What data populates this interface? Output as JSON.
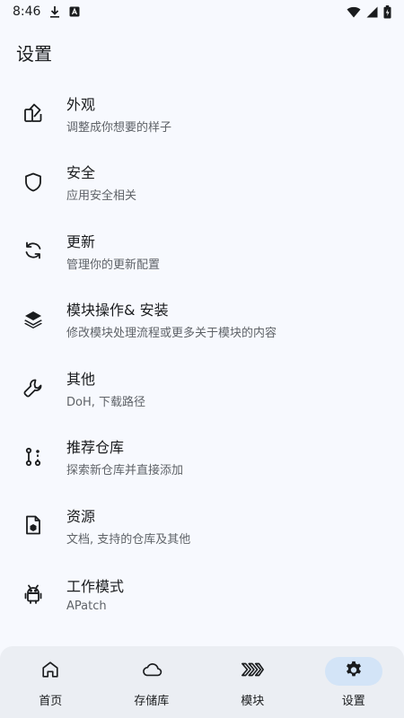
{
  "status_bar": {
    "time": "8:46",
    "icons": [
      "download-icon",
      "notification-a-icon",
      "wifi-icon",
      "signal-icon",
      "battery-icon"
    ]
  },
  "page": {
    "title": "设置"
  },
  "settings": [
    {
      "icon": "appearance-icon",
      "title": "外观",
      "subtitle": "调整成你想要的样子"
    },
    {
      "icon": "shield-icon",
      "title": "安全",
      "subtitle": "应用安全相关"
    },
    {
      "icon": "sync-icon",
      "title": "更新",
      "subtitle": "管理你的更新配置"
    },
    {
      "icon": "layers-icon",
      "title": "模块操作& 安装",
      "subtitle": "修改模块处理流程或更多关于模块的内容"
    },
    {
      "icon": "wrench-icon",
      "title": "其他",
      "subtitle": "DoH, 下载路径"
    },
    {
      "icon": "repo-icon",
      "title": "推荐仓库",
      "subtitle": "探索新仓库并直接添加"
    },
    {
      "icon": "document-icon",
      "title": "资源",
      "subtitle": "文档, 支持的仓库及其他"
    },
    {
      "icon": "android-icon",
      "title": "工作模式",
      "subtitle": "APatch"
    }
  ],
  "bottom_nav": [
    {
      "icon": "home-icon",
      "label": "首页",
      "active": false
    },
    {
      "icon": "cloud-icon",
      "label": "存储库",
      "active": false
    },
    {
      "icon": "modules-icon",
      "label": "模块",
      "active": false
    },
    {
      "icon": "gear-icon",
      "label": "设置",
      "active": true
    }
  ],
  "colors": {
    "background": "#f7f9fe",
    "nav_background": "#ebeef3",
    "active_pill": "#d3e4f7",
    "text_primary": "#1a1c1e",
    "text_secondary": "#5f6368"
  }
}
